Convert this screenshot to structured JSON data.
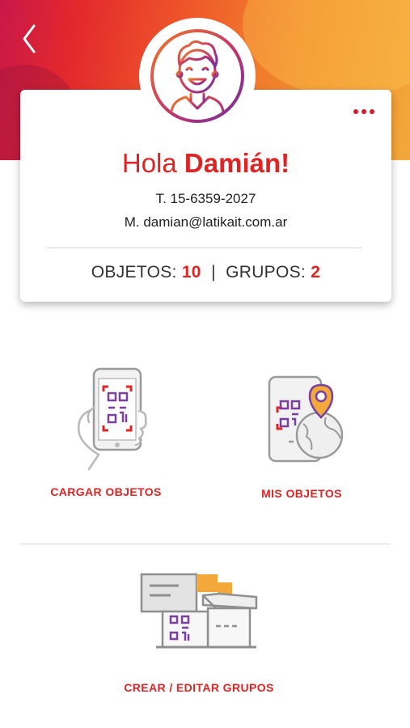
{
  "header": {
    "back_icon": "chevron-left-icon",
    "more_icon": "ellipsis-icon",
    "colors": {
      "gradient_start": "#c9184a",
      "gradient_mid": "#ef5a2a",
      "gradient_end": "#f3a83a"
    }
  },
  "profile": {
    "avatar_icon": "boy-avatar-icon",
    "greeting_prefix": "Hola",
    "name": "Damián!",
    "phone": "T. 15-6359-2027",
    "email": "M. damian@latikait.com.ar",
    "objects_label": "OBJETOS:",
    "objects_count": "10",
    "separator": "|",
    "groups_label": "GRUPOS:",
    "groups_count": "2"
  },
  "actions": {
    "load_objects": {
      "label": "CARGAR OBJETOS",
      "icon": "hand-phone-qr-icon"
    },
    "my_objects": {
      "label": "MIS OBJETOS",
      "icon": "phone-qr-location-icon"
    },
    "groups": {
      "label": "CREAR / EDITAR GRUPOS",
      "icon": "box-qr-icon"
    }
  },
  "colors": {
    "accent": "#e02424",
    "qr_purple": "#7b3fa0"
  }
}
